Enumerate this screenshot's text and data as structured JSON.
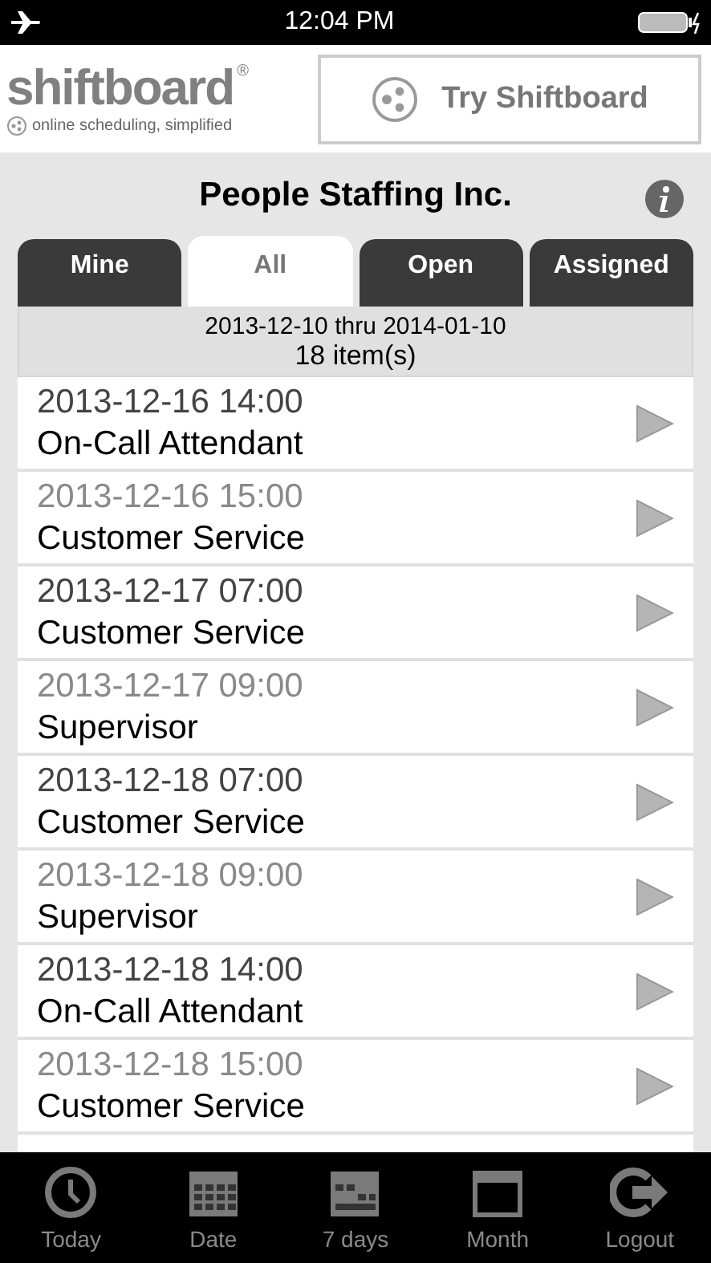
{
  "status_bar": {
    "time": "12:04 PM"
  },
  "header": {
    "logo": "shiftboard",
    "logo_mark": "®",
    "tagline": "online scheduling, simplified",
    "try_button": "Try Shiftboard"
  },
  "title": "People Staffing Inc.",
  "tabs": [
    {
      "label": "Mine",
      "selected": false
    },
    {
      "label": "All",
      "selected": true
    },
    {
      "label": "Open",
      "selected": false
    },
    {
      "label": "Assigned",
      "selected": false
    }
  ],
  "range": "2013-12-10 thru 2014-01-10",
  "count": "18 item(s)",
  "shifts": [
    {
      "time": "2013-12-16 14:00",
      "role": "On-Call Attendant",
      "dimmed": false
    },
    {
      "time": "2013-12-16 15:00",
      "role": "Customer Service",
      "dimmed": true
    },
    {
      "time": "2013-12-17 07:00",
      "role": "Customer Service",
      "dimmed": false
    },
    {
      "time": "2013-12-17 09:00",
      "role": "Supervisor",
      "dimmed": true
    },
    {
      "time": "2013-12-18 07:00",
      "role": "Customer Service",
      "dimmed": false
    },
    {
      "time": "2013-12-18 09:00",
      "role": "Supervisor",
      "dimmed": true
    },
    {
      "time": "2013-12-18 14:00",
      "role": "On-Call Attendant",
      "dimmed": false
    },
    {
      "time": "2013-12-18 15:00",
      "role": "Customer Service",
      "dimmed": true
    }
  ],
  "toolbar": [
    {
      "label": "Today",
      "kind": "clock"
    },
    {
      "label": "Date",
      "kind": "grid"
    },
    {
      "label": "7 days",
      "kind": "week"
    },
    {
      "label": "Month",
      "kind": "month"
    },
    {
      "label": "Logout",
      "kind": "logout"
    }
  ]
}
